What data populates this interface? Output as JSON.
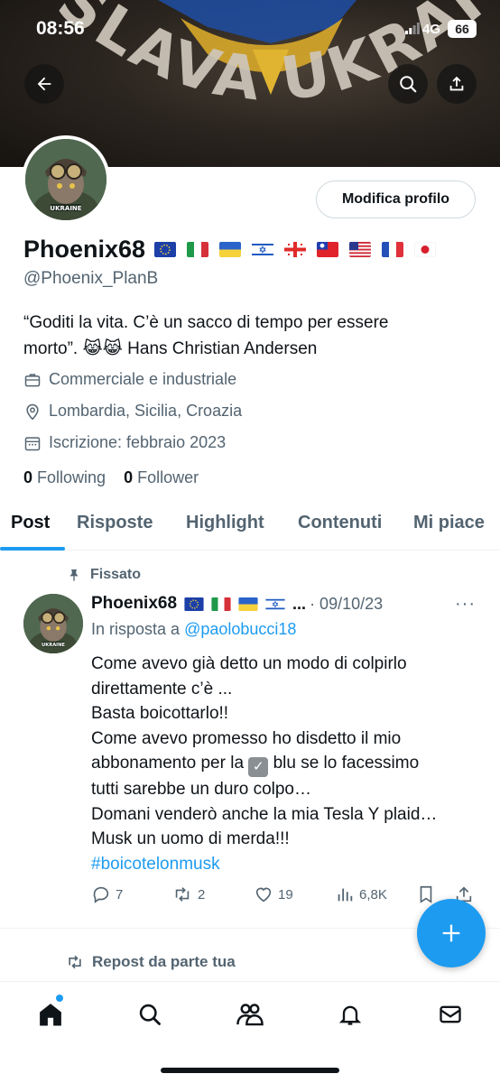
{
  "status_bar": {
    "time": "08:56",
    "network": "4G",
    "battery": "66"
  },
  "banner": {
    "text": "SLAVA UKRAINI"
  },
  "profile": {
    "avatar_badge": "UKRAINE",
    "edit_button": "Modifica profilo",
    "name": "Phoenix68",
    "handle": "@Phoenix_PlanB",
    "bio_line1": "“Goditi la vita. C’è un sacco di tempo per essere",
    "bio_line2_text": "morto”.",
    "bio_emoji": "😹😹",
    "bio_author": "Hans Christian Andersen",
    "profession": "Commerciale e industriale",
    "location": "Lombardia, Sicilia, Croazia",
    "joined": "Iscrizione: febbraio 2023",
    "following_count": "0",
    "following_label": "Following",
    "followers_count": "0",
    "followers_label": "Follower"
  },
  "tabs": [
    {
      "label": "Post"
    },
    {
      "label": "Risposte"
    },
    {
      "label": "Highlight"
    },
    {
      "label": "Contenuti"
    },
    {
      "label": "Mi piace"
    }
  ],
  "post": {
    "pinned_label": "Fissato",
    "author": "Phoenix68",
    "ellipsis": "...",
    "date": "· 09/10/23",
    "reply_prefix": "In risposta a",
    "reply_handle": "@paolobucci18",
    "lines": [
      "Come avevo già detto un modo di colpirlo",
      "direttamente c’è ...",
      "Basta boicottarlo!!",
      "Come avevo promesso ho disdetto il mio"
    ],
    "line5_a": "abbonamento per la",
    "line5_b": "blu se lo facessimo",
    "lines_after": [
      "tutti sarebbe un duro colpo…",
      "Domani venderò anche la mia Tesla Y plaid…",
      "Musk un uomo di merda!!!"
    ],
    "hashtag": "#boicotelonmusk",
    "replies": "7",
    "reposts": "2",
    "likes": "19",
    "views": "6,8K"
  },
  "repost_banner": "Repost da parte tua",
  "colors": {
    "accent": "#1d9bf0",
    "text": "#0f1419",
    "secondary": "#536471"
  }
}
